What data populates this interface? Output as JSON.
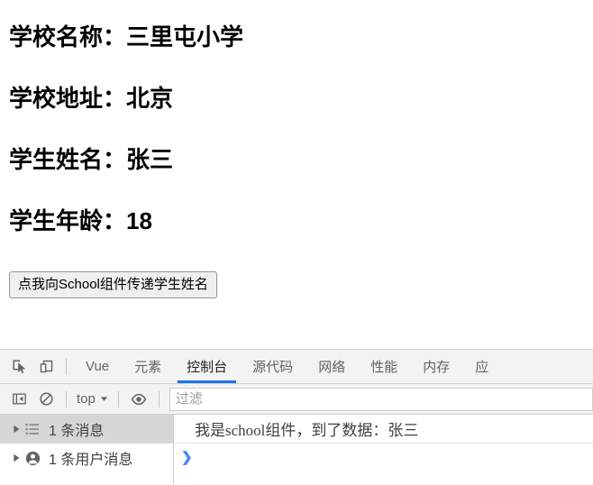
{
  "page": {
    "rows": [
      {
        "label": "学校名称：",
        "value": "三里屯小学"
      },
      {
        "label": "学校地址：",
        "value": "北京"
      },
      {
        "label": "学生姓名：",
        "value": "张三"
      },
      {
        "label": "学生年龄：",
        "value": "18"
      }
    ],
    "button_label": "点我向School组件传递学生姓名"
  },
  "devtools": {
    "icons": {
      "inspect": "inspect-element-icon",
      "device": "device-toolbar-icon",
      "sidebar_toggle": "console-sidebar-toggle-icon",
      "clear": "clear-console-icon",
      "eye": "live-expression-eye-icon",
      "chevron": "chevron-down-icon"
    },
    "tabs": [
      {
        "label": "Vue",
        "active": false
      },
      {
        "label": "元素",
        "active": false
      },
      {
        "label": "控制台",
        "active": true
      },
      {
        "label": "源代码",
        "active": false
      },
      {
        "label": "网络",
        "active": false
      },
      {
        "label": "性能",
        "active": false
      },
      {
        "label": "内存",
        "active": false
      },
      {
        "label": "应",
        "active": false
      }
    ],
    "active_tab_color": "#1a73e8",
    "toolbar": {
      "context": "top",
      "filter_placeholder": "过滤",
      "filter_value": ""
    },
    "sidebar": [
      {
        "label": "1 条消息",
        "icon": "message-list-icon",
        "selected": true
      },
      {
        "label": "1 条用户消息",
        "icon": "user-message-icon",
        "selected": false
      }
    ],
    "console": {
      "message": "我是school组件，到了数据：张三",
      "prompt": "❯"
    }
  }
}
